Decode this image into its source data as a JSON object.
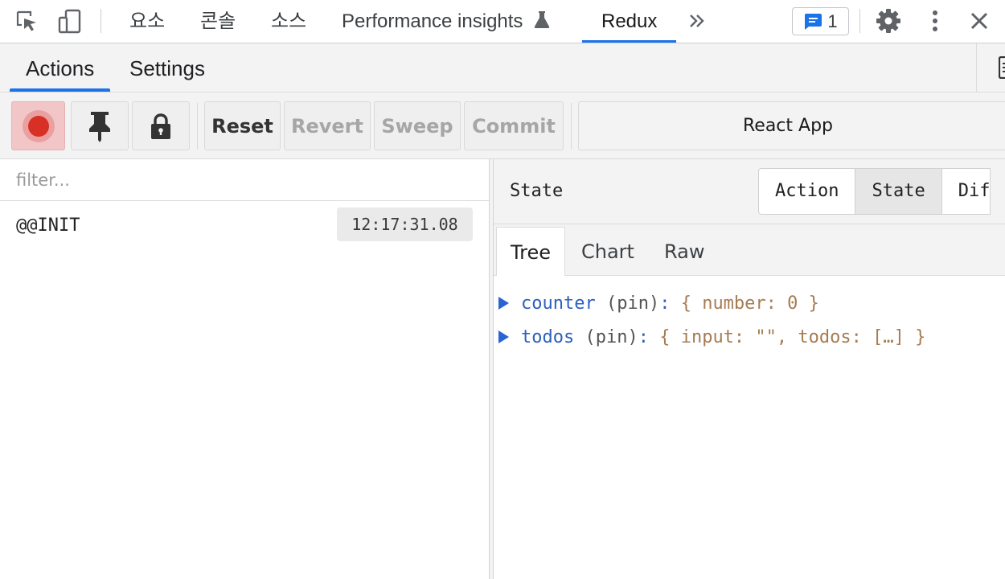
{
  "devtools": {
    "tabs": [
      "요소",
      "콘솔",
      "소스",
      "Performance insights",
      "Redux"
    ],
    "active_tab": "Redux",
    "issues_count": "1",
    "accent_color": "#1a73e8"
  },
  "panel": {
    "tabs": [
      "Actions",
      "Settings"
    ],
    "active_tab": "Actions"
  },
  "toolbar": {
    "reset": "Reset",
    "revert": "Revert",
    "sweep": "Sweep",
    "commit": "Commit",
    "instance": "React App",
    "record_color": "#d93025"
  },
  "actions": {
    "filter_placeholder": "filter...",
    "items": [
      {
        "name": "@@INIT",
        "time": "12:17:31.08"
      }
    ]
  },
  "inspector": {
    "title": "State",
    "modes": [
      "Action",
      "State",
      "Dif"
    ],
    "selected_mode": "State",
    "subtabs": [
      "Tree",
      "Chart",
      "Raw"
    ],
    "selected_subtab": "Tree",
    "tree": [
      {
        "key": "counter",
        "pin": "(pin)",
        "colon": ":",
        "value": "{ number: 0 }"
      },
      {
        "key": "todos",
        "pin": "(pin)",
        "colon": ":",
        "value": "{ input: \"\", todos: […] }"
      }
    ]
  }
}
